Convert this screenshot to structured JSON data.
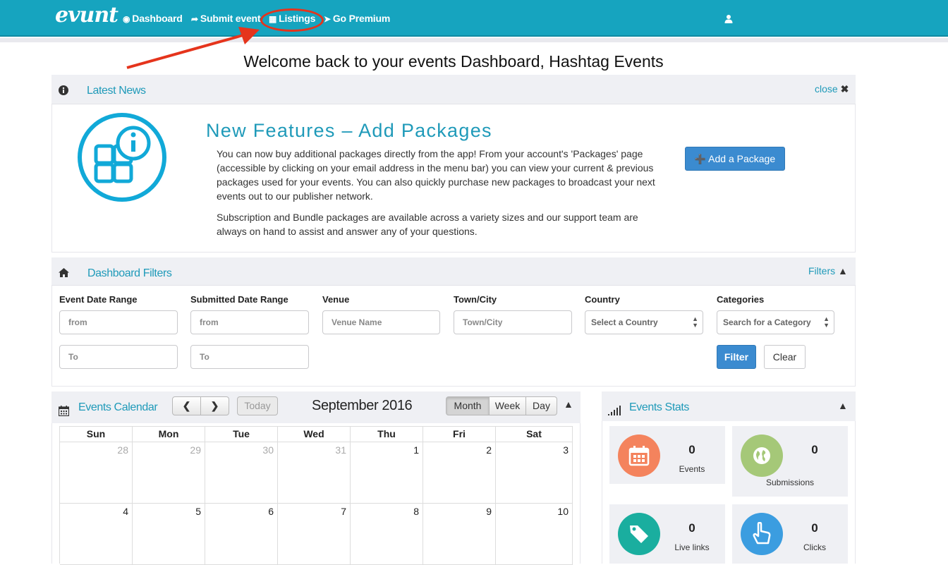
{
  "nav": {
    "brand": "evunt",
    "items": [
      {
        "label": "Dashboard"
      },
      {
        "label": "Submit event"
      },
      {
        "label": "Listings"
      },
      {
        "label": "Go Premium"
      }
    ]
  },
  "welcome": "Welcome back to your events Dashboard, Hashtag Events",
  "news": {
    "title": "Latest News",
    "close_label": "close",
    "heading": "New Features – Add Packages",
    "paragraph1": "You can now buy additional packages directly from the app! From your account's 'Packages' page (accessible by clicking on your email address in the menu bar) you can view your current & previous packages used for your events. You can also quickly purchase new packages to broadcast your next events out to our publisher network.",
    "paragraph2": "Subscription and Bundle packages are available across a variety sizes and our support team are always on hand to assist and answer any of your questions.",
    "button": "Add a Package"
  },
  "filters": {
    "title": "Dashboard Filters",
    "toggle_label": "Filters",
    "event_date_label": "Event Date Range",
    "event_from": "from",
    "event_to": "To",
    "submitted_date_label": "Submitted Date Range",
    "submitted_from": "from",
    "submitted_to": "To",
    "venue_label": "Venue",
    "venue_placeholder": "Venue Name",
    "town_label": "Town/City",
    "town_placeholder": "Town/City",
    "country_label": "Country",
    "country_selected": "Select a Country",
    "categories_label": "Categories",
    "categories_selected": "Search for a Category",
    "filter_button": "Filter",
    "clear_button": "Clear"
  },
  "calendar": {
    "title": "Events Calendar",
    "today_button": "Today",
    "month_title": "September 2016",
    "views": [
      "Month",
      "Week",
      "Day"
    ],
    "active_view": "Month",
    "days_of_week": [
      "Sun",
      "Mon",
      "Tue",
      "Wed",
      "Thu",
      "Fri",
      "Sat"
    ],
    "week1": [
      "28",
      "29",
      "30",
      "31",
      "1",
      "2",
      "3"
    ],
    "week2": [
      "4",
      "5",
      "6",
      "7",
      "8",
      "9",
      "10"
    ]
  },
  "stats": {
    "title": "Events Stats",
    "events": {
      "value": "0",
      "label": "Events",
      "color": "#f4835d"
    },
    "submissions": {
      "value": "0",
      "label": "Submissions",
      "color": "#a5c878"
    },
    "live_links": {
      "value": "0",
      "label": "Live links",
      "color": "#1aae9f"
    },
    "clicks": {
      "value": "0",
      "label": "Clicks",
      "color": "#3b9de0"
    }
  },
  "colors": {
    "navbar": "#16a4bf",
    "accent": "#1f9ab9",
    "primary_button": "#3b8bd0",
    "annotation_red": "#e5341c"
  }
}
